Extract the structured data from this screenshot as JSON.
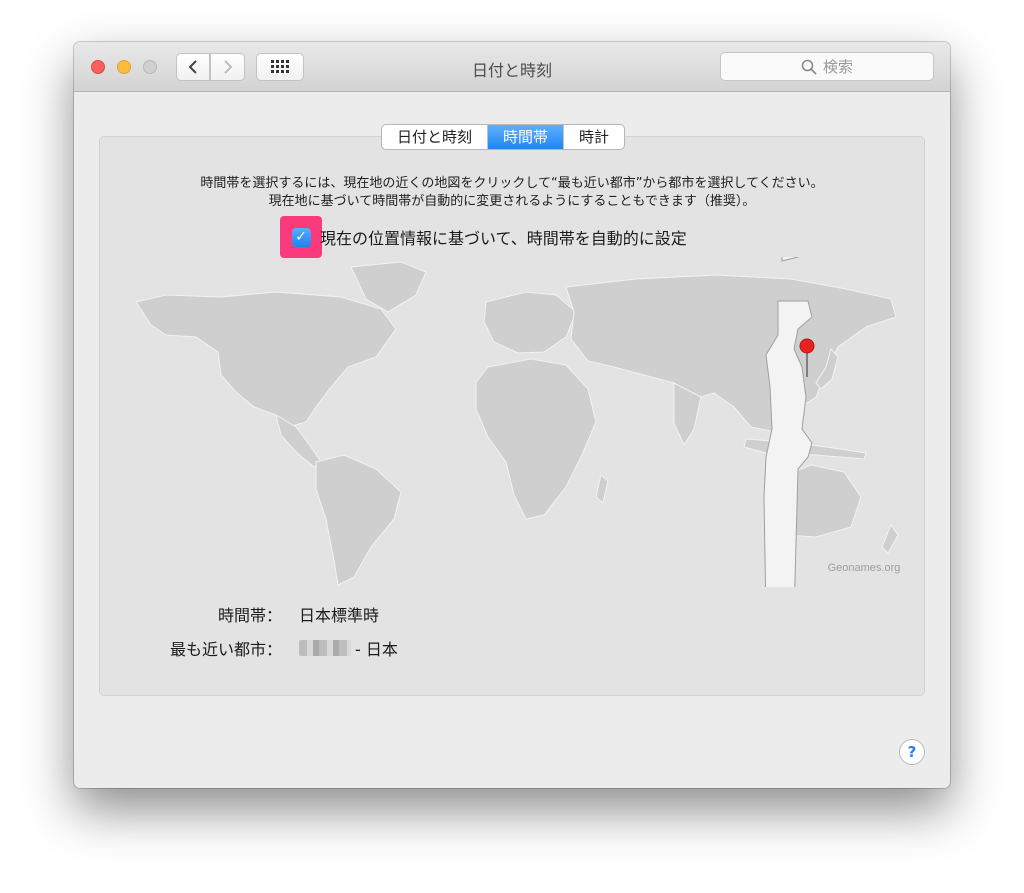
{
  "window": {
    "title": "日付と時刻"
  },
  "toolbar": {
    "back_icon": "chevron-left-icon",
    "forward_icon": "chevron-right-icon",
    "grid_icon": "grid-icon",
    "search_placeholder": "検索"
  },
  "tabs": [
    {
      "label": "日付と時刻",
      "active": false
    },
    {
      "label": "時間帯",
      "active": true
    },
    {
      "label": "時計",
      "active": false
    }
  ],
  "description": {
    "line1": "時間帯を選択するには、現在地の近くの地図をクリックして“最も近い都市”から都市を選択してください。",
    "line2": "現在地に基づいて時間帯が自動的に変更されるようにすることもできます（推奨）。"
  },
  "auto_setting": {
    "label": "現在の位置情報に基づいて、時間帯を自動的に設定",
    "checked": true,
    "highlight_color": "#fb3a7d"
  },
  "map": {
    "credit": "Geonames.org"
  },
  "info": {
    "timezone_label": "時間帯：",
    "timezone_value": "日本標準時",
    "city_label": "最も近い都市：",
    "city_value": "- 日本"
  },
  "help": {
    "label": "?"
  },
  "colors": {
    "accent": "#1f85f4",
    "pin": "#e8231f"
  }
}
